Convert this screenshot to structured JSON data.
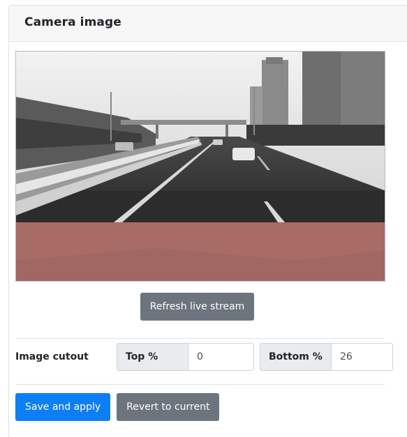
{
  "card": {
    "title": "Camera image"
  },
  "camera": {
    "mask_color": "#a86b66",
    "cutout_bottom_percent": 26
  },
  "refresh": {
    "label": "Refresh live stream"
  },
  "cutout": {
    "label": "Image cutout",
    "top": {
      "label": "Top %",
      "value": "0"
    },
    "bottom": {
      "label": "Bottom %",
      "value": "26"
    }
  },
  "actions": {
    "save_label": "Save and apply",
    "revert_label": "Revert to current"
  },
  "colors": {
    "primary": "#0d7ff5",
    "secondary": "#6c757d"
  }
}
